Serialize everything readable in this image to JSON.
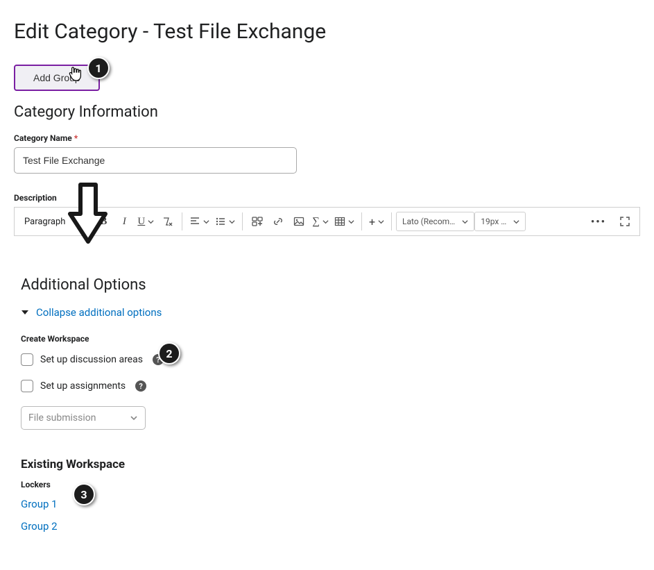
{
  "page": {
    "title": "Edit Category - Test File Exchange"
  },
  "buttons": {
    "add_group": "Add Group"
  },
  "category_info": {
    "heading": "Category Information",
    "name_label": "Category Name",
    "name_req": "*",
    "name_value": "Test File Exchange",
    "description_label": "Description"
  },
  "toolbar": {
    "paragraph": "Paragraph",
    "font": "Lato (Recom…",
    "size": "19px …",
    "bold": "B",
    "italic": "I",
    "underline": "U"
  },
  "additional": {
    "heading": "Additional Options",
    "collapse": "Collapse additional options",
    "create_workspace_label": "Create Workspace",
    "discussion": "Set up discussion areas",
    "assignments": "Set up assignments",
    "file_submission": "File submission"
  },
  "existing": {
    "heading": "Existing Workspace",
    "lockers_label": "Lockers",
    "groups": [
      "Group 1",
      "Group 2"
    ]
  },
  "callouts": {
    "one": "1",
    "two": "2",
    "three": "3"
  }
}
